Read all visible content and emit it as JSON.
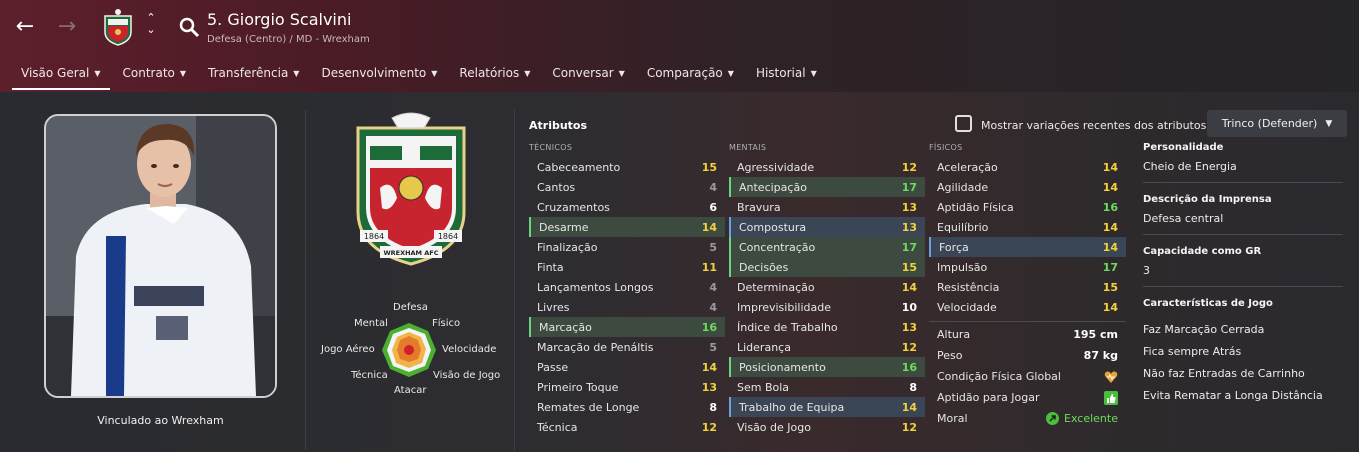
{
  "header": {
    "player_title": "5. Giorgio Scalvini",
    "player_subtitle": "Defesa (Centro) / MD - Wrexham",
    "tabs": [
      {
        "label": "Visão Geral",
        "active": true
      },
      {
        "label": "Contrato"
      },
      {
        "label": "Transferência"
      },
      {
        "label": "Desenvolvimento"
      },
      {
        "label": "Relatórios"
      },
      {
        "label": "Conversar"
      },
      {
        "label": "Comparação"
      },
      {
        "label": "Historial"
      }
    ],
    "icons": {
      "back": "back-arrow-icon",
      "forward": "forward-arrow-icon",
      "search": "search-icon",
      "switch": "chevron-updown-icon"
    }
  },
  "profile": {
    "contract_label": "Vinculado ao Wrexham",
    "crest_text": {
      "left_year": "1864",
      "right_year": "1864",
      "banner": "WREXHAM AFC"
    }
  },
  "radar": {
    "labels": {
      "top": "Defesa",
      "top_left": "Mental",
      "top_right": "Físico",
      "left": "Jogo Aéreo",
      "right": "Velocidade",
      "bottom_left": "Técnica",
      "bottom_right": "Visão de Jogo",
      "bottom": "Atacar"
    }
  },
  "attributes": {
    "title": "Atributos",
    "show_changes_label": "Mostrar variações recentes dos atributos",
    "role_dropdown": "Trinco (Defender)",
    "technical": {
      "header": "TÉCNICOS",
      "items": [
        {
          "name": "Cabeceamento",
          "value": "15",
          "color": "yellow"
        },
        {
          "name": "Cantos",
          "value": "4",
          "color": "grey"
        },
        {
          "name": "Cruzamentos",
          "value": "6",
          "color": "white"
        },
        {
          "name": "Desarme",
          "value": "14",
          "color": "yellow",
          "hl": "green"
        },
        {
          "name": "Finalização",
          "value": "5",
          "color": "grey"
        },
        {
          "name": "Finta",
          "value": "11",
          "color": "yellow"
        },
        {
          "name": "Lançamentos Longos",
          "value": "4",
          "color": "grey"
        },
        {
          "name": "Livres",
          "value": "4",
          "color": "grey"
        },
        {
          "name": "Marcação",
          "value": "16",
          "color": "green",
          "hl": "green"
        },
        {
          "name": "Marcação de Penáltis",
          "value": "5",
          "color": "grey"
        },
        {
          "name": "Passe",
          "value": "14",
          "color": "yellow"
        },
        {
          "name": "Primeiro Toque",
          "value": "13",
          "color": "yellow"
        },
        {
          "name": "Remates de Longe",
          "value": "8",
          "color": "white"
        },
        {
          "name": "Técnica",
          "value": "12",
          "color": "yellow"
        }
      ]
    },
    "mental": {
      "header": "MENTAIS",
      "items": [
        {
          "name": "Agressividade",
          "value": "12",
          "color": "yellow"
        },
        {
          "name": "Antecipação",
          "value": "17",
          "color": "green",
          "hl": "green"
        },
        {
          "name": "Bravura",
          "value": "13",
          "color": "yellow"
        },
        {
          "name": "Compostura",
          "value": "13",
          "color": "yellow",
          "hl": "blue"
        },
        {
          "name": "Concentração",
          "value": "17",
          "color": "green",
          "hl": "green"
        },
        {
          "name": "Decisões",
          "value": "15",
          "color": "yellow",
          "hl": "green"
        },
        {
          "name": "Determinação",
          "value": "14",
          "color": "yellow"
        },
        {
          "name": "Imprevisibilidade",
          "value": "10",
          "color": "white"
        },
        {
          "name": "Índice de Trabalho",
          "value": "13",
          "color": "yellow"
        },
        {
          "name": "Liderança",
          "value": "12",
          "color": "yellow"
        },
        {
          "name": "Posicionamento",
          "value": "16",
          "color": "green",
          "hl": "green"
        },
        {
          "name": "Sem Bola",
          "value": "8",
          "color": "white"
        },
        {
          "name": "Trabalho de Equipa",
          "value": "14",
          "color": "yellow",
          "hl": "blue"
        },
        {
          "name": "Visão de Jogo",
          "value": "12",
          "color": "yellow"
        }
      ]
    },
    "physical": {
      "header": "FÍSICOS",
      "items": [
        {
          "name": "Aceleração",
          "value": "14",
          "color": "yellow"
        },
        {
          "name": "Agilidade",
          "value": "14",
          "color": "yellow"
        },
        {
          "name": "Aptidão Física",
          "value": "16",
          "color": "green"
        },
        {
          "name": "Equilíbrio",
          "value": "14",
          "color": "yellow"
        },
        {
          "name": "Força",
          "value": "14",
          "color": "yellow",
          "hl": "blue"
        },
        {
          "name": "Impulsão",
          "value": "17",
          "color": "green"
        },
        {
          "name": "Resistência",
          "value": "15",
          "color": "yellow"
        },
        {
          "name": "Velocidade",
          "value": "14",
          "color": "yellow"
        }
      ]
    },
    "extra": {
      "height_label": "Altura",
      "height_value": "195 cm",
      "weight_label": "Peso",
      "weight_value": "87 kg",
      "condition_label": "Condição Física Global",
      "fitness_label": "Aptidão para Jogar",
      "morale_label": "Moral",
      "morale_value": "Excelente"
    }
  },
  "side_panel": {
    "personality_head": "Personalidade",
    "personality": "Cheio de Energia",
    "press_head": "Descrição da Imprensa",
    "press": "Defesa central",
    "gk_head": "Capacidade como GR",
    "gk": "3",
    "traits_head": "Características de Jogo",
    "traits": [
      "Faz Marcação Cerrada",
      "Fica sempre Atrás",
      "Não faz Entradas de Carrinho",
      "Evita Rematar a Longa Distância"
    ]
  },
  "colors": {
    "yellow": "#f3d23a",
    "green": "#6ddc5c",
    "accent_red": "#5d1f2c"
  }
}
